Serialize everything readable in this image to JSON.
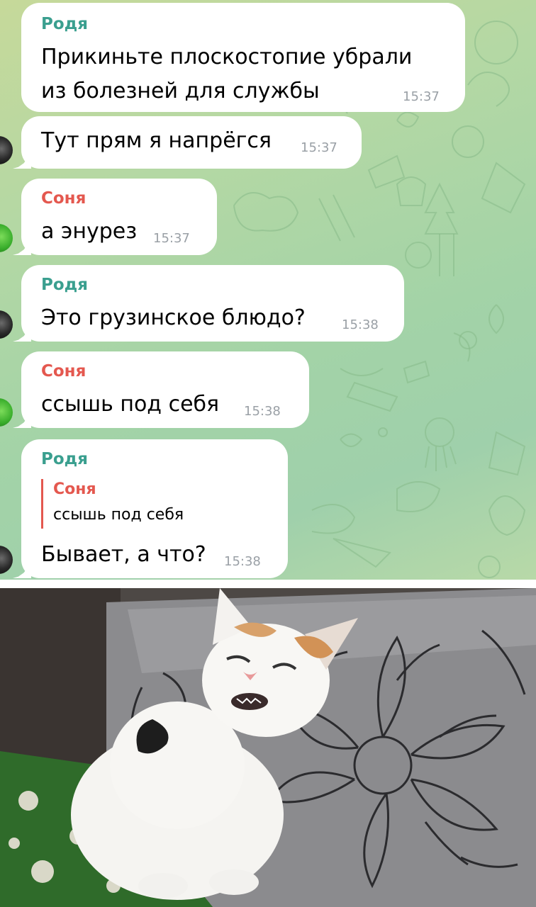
{
  "colors": {
    "rodya_name": "#3a9f8f",
    "sonya_name": "#e4584f",
    "bubble": "#ffffff",
    "time": "#9aa0a6",
    "background_green": "#a3d3a7"
  },
  "messages": [
    {
      "sender": "Родя",
      "lines": [
        "Прикиньте плоскостопие убрали",
        "из болезней для службы"
      ],
      "time": "15:37"
    },
    {
      "sender": "",
      "lines": [
        "Тут прям я напрёгся"
      ],
      "time": "15:37"
    },
    {
      "sender": "Соня",
      "lines": [
        "а энурез"
      ],
      "time": "15:37"
    },
    {
      "sender": "Родя",
      "lines": [
        "Это грузинское блюдо?"
      ],
      "time": "15:38"
    },
    {
      "sender": "Соня",
      "lines": [
        "ссышь под себя"
      ],
      "time": "15:38"
    },
    {
      "sender": "Родя",
      "reply": {
        "sender": "Соня",
        "text": "ссышь под себя"
      },
      "lines": [
        "Бывает, а что?"
      ],
      "time": "15:38"
    }
  ],
  "photo": {
    "subject": "cat-photo"
  }
}
